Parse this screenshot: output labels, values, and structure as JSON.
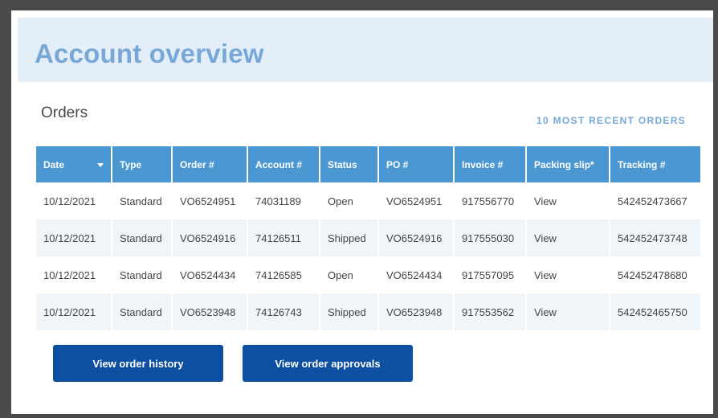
{
  "page": {
    "title": "Account overview"
  },
  "orders": {
    "heading": "Orders",
    "recent_label": "10 MOST RECENT ORDERS",
    "columns": [
      "Date",
      "Type",
      "Order #",
      "Account #",
      "Status",
      "PO #",
      "Invoice #",
      "Packing slip*",
      "Tracking #"
    ],
    "rows": [
      {
        "date": "10/12/2021",
        "type": "Standard",
        "order": "VO6524951",
        "account": "74031189",
        "status": "Open",
        "po": "VO6524951",
        "invoice": "917556770",
        "slip": "View",
        "tracking": "542452473667"
      },
      {
        "date": "10/12/2021",
        "type": "Standard",
        "order": "VO6524916",
        "account": "74126511",
        "status": "Shipped",
        "po": "VO6524916",
        "invoice": "917555030",
        "slip": "View",
        "tracking": "542452473748"
      },
      {
        "date": "10/12/2021",
        "type": "Standard",
        "order": "VO6524434",
        "account": "74126585",
        "status": "Open",
        "po": "VO6524434",
        "invoice": "917557095",
        "slip": "View",
        "tracking": "542452478680"
      },
      {
        "date": "10/12/2021",
        "type": "Standard",
        "order": "VO6523948",
        "account": "74126743",
        "status": "Shipped",
        "po": "VO6523948",
        "invoice": "917553562",
        "slip": "View",
        "tracking": "542452465750"
      }
    ]
  },
  "buttons": {
    "history_label": "View order history",
    "approvals_label": "View order approvals"
  },
  "colors": {
    "header_band": "#e4eef8",
    "title": "#77a8d8",
    "table_header": "#4a97d1",
    "link": "#2d6ea8",
    "button": "#0d4fa0"
  },
  "icons": {
    "sort": "caret-down-icon"
  }
}
